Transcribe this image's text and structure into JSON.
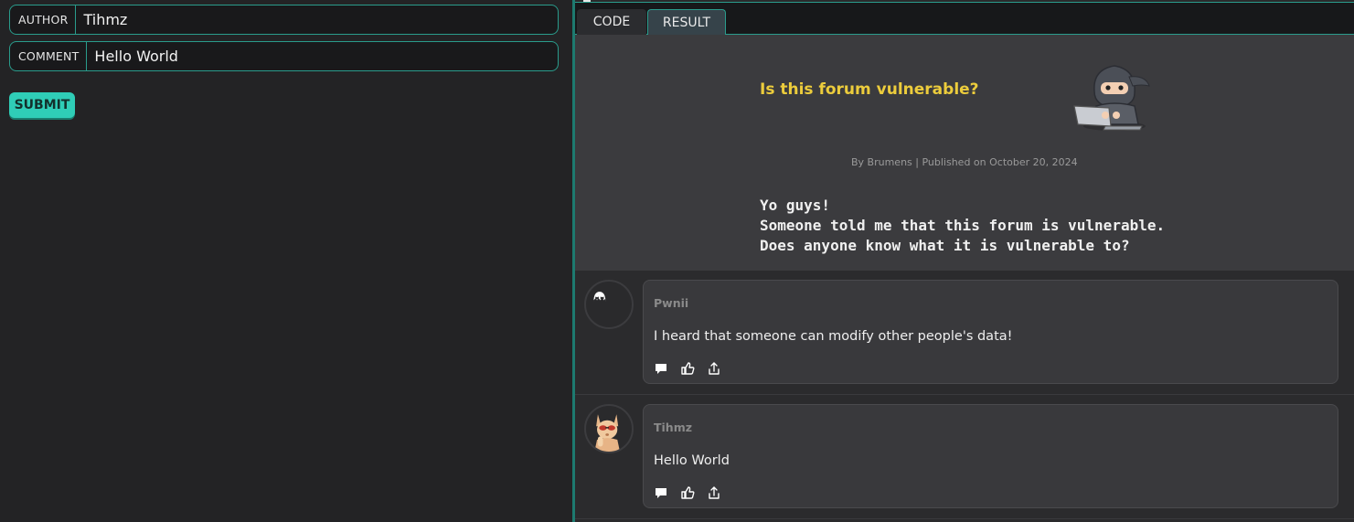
{
  "form": {
    "author_label": "AUTHOR",
    "author_value": "Tihmz",
    "comment_label": "COMMENT",
    "comment_value": "Hello World",
    "submit_label": "SUBMIT"
  },
  "tabs": [
    {
      "label": "CODE",
      "active": false
    },
    {
      "label": "RESULT",
      "active": true
    }
  ],
  "post": {
    "title": "Is this forum vulnerable?",
    "meta": "By Brumens | Published on October 20, 2024",
    "body": "Yo guys!\nSomeone told me that this forum is vulnerable.\nDoes anyone know what it is vulnerable to?"
  },
  "comments": [
    {
      "author": "Pwnii",
      "text": "I heard that someone can modify other people's data!",
      "avatar": "ghost-avatar-icon"
    },
    {
      "author": "Tihmz",
      "text": "Hello World",
      "avatar": "cool-cat-avatar-icon"
    }
  ],
  "colors": {
    "accent": "#2fcdb7",
    "title": "#eccc3c",
    "border": "#2a9c8c"
  }
}
